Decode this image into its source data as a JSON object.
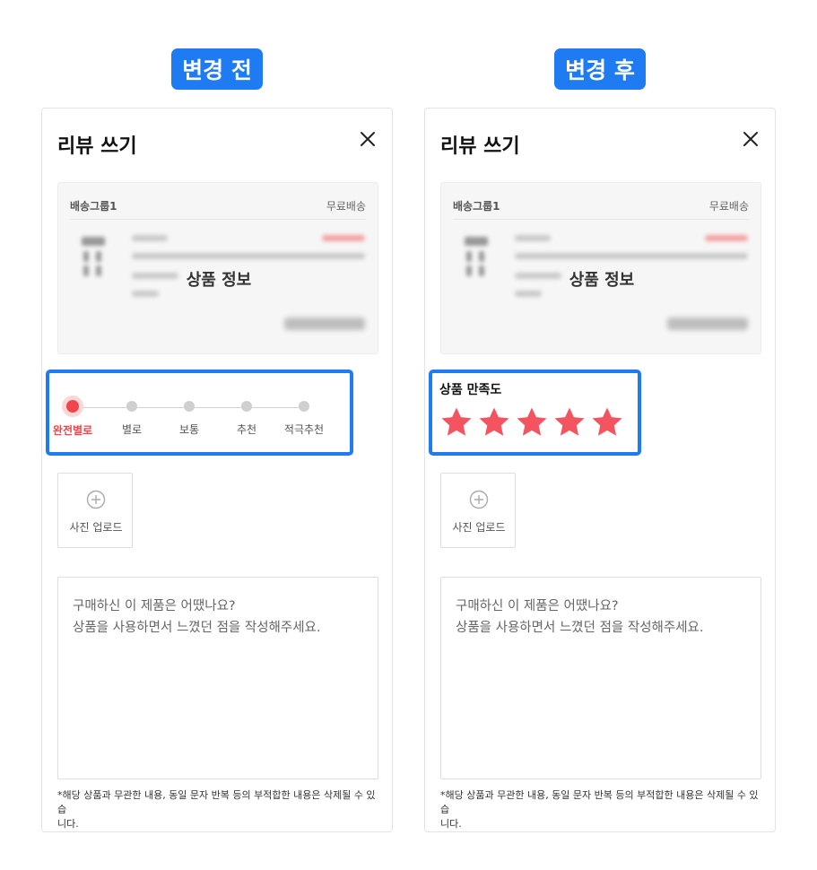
{
  "labels": {
    "before": "변경 전",
    "after": "변경 후"
  },
  "modal": {
    "title": "리뷰 쓰기",
    "product": {
      "shipping_group": "배송그룹1",
      "shipping_type": "무료배송",
      "overlay_label": "상품 정보"
    },
    "upload": {
      "label": "사진 업로드"
    },
    "review": {
      "placeholder_line1": "구매하신 이 제품은 어땠나요?",
      "placeholder_line2": "상품을 사용하면서 느꼈던 점을 작성해주세요."
    },
    "note_line1": "*해당 상품과 무관한 내용, 동일 문자 반복 등의 부적합한 내용은 삭제될 수 있습",
    "note_line2": "니다."
  },
  "before": {
    "rating_options": [
      "완전별로",
      "별로",
      "보통",
      "추천",
      "적극추천"
    ],
    "selected_index": 0
  },
  "after": {
    "satisfaction_title": "상품 만족도",
    "stars_filled": 5,
    "stars_total": 5
  },
  "colors": {
    "accent_blue": "#1e7bf2",
    "rating_red": "#f0454a",
    "star_red": "#f45460"
  }
}
